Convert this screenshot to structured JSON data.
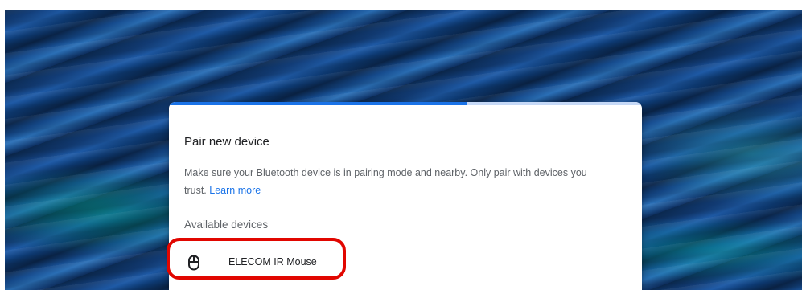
{
  "dialog": {
    "title": "Pair new device",
    "description": "Make sure your Bluetooth device is in pairing mode and nearby. Only pair with devices you trust.",
    "learn_more": "Learn more",
    "progress_fraction": 0.63,
    "section_label": "Available devices",
    "devices": [
      {
        "name": "ELECOM IR Mouse",
        "icon": "mouse-icon"
      }
    ]
  },
  "colors": {
    "accent": "#1a73e8",
    "highlight": "#e10600"
  }
}
